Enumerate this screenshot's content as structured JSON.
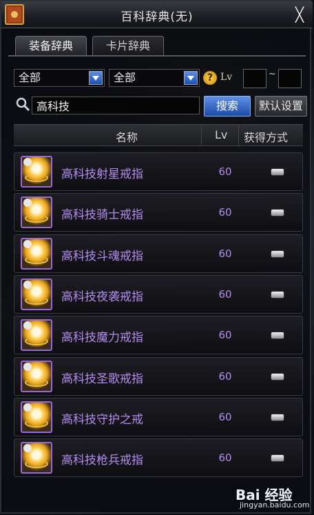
{
  "window": {
    "title": "百科辞典(无)",
    "close_label": "╳"
  },
  "tabs": [
    {
      "label": "装备辞典"
    },
    {
      "label": "卡片辞典"
    }
  ],
  "filters": {
    "category_1": "全部",
    "category_2": "全部",
    "help_label": "?",
    "lv_label": "Lv",
    "lv_min": "",
    "lv_max": "",
    "lv_separator": "~"
  },
  "search": {
    "value": "高科技",
    "button_label": "搜索",
    "default_label": "默认设置"
  },
  "table": {
    "headers": {
      "name": "名称",
      "lv": "Lv",
      "obtain": "获得方式"
    },
    "rows": [
      {
        "name": "高科技射星戒指",
        "lv": "60"
      },
      {
        "name": "高科技骑士戒指",
        "lv": "60"
      },
      {
        "name": "高科技斗魂戒指",
        "lv": "60"
      },
      {
        "name": "高科技夜袭戒指",
        "lv": "60"
      },
      {
        "name": "高科技魔力戒指",
        "lv": "60"
      },
      {
        "name": "高科技圣歌戒指",
        "lv": "60"
      },
      {
        "name": "高科技守护之戒",
        "lv": "60"
      },
      {
        "name": "高科技枪兵戒指",
        "lv": "60"
      }
    ]
  },
  "watermark": {
    "logo": "Bai 经验",
    "url": "jingyan.baidu.com"
  },
  "colors": {
    "item_name": "#b48cf0",
    "accent_blue": "#1d4aa6"
  },
  "icons": {
    "book": "book-icon",
    "search": "search-icon",
    "ring": "ring-icon",
    "dropdown": "chevron-down-icon",
    "obtain": "obtain-method-icon"
  }
}
